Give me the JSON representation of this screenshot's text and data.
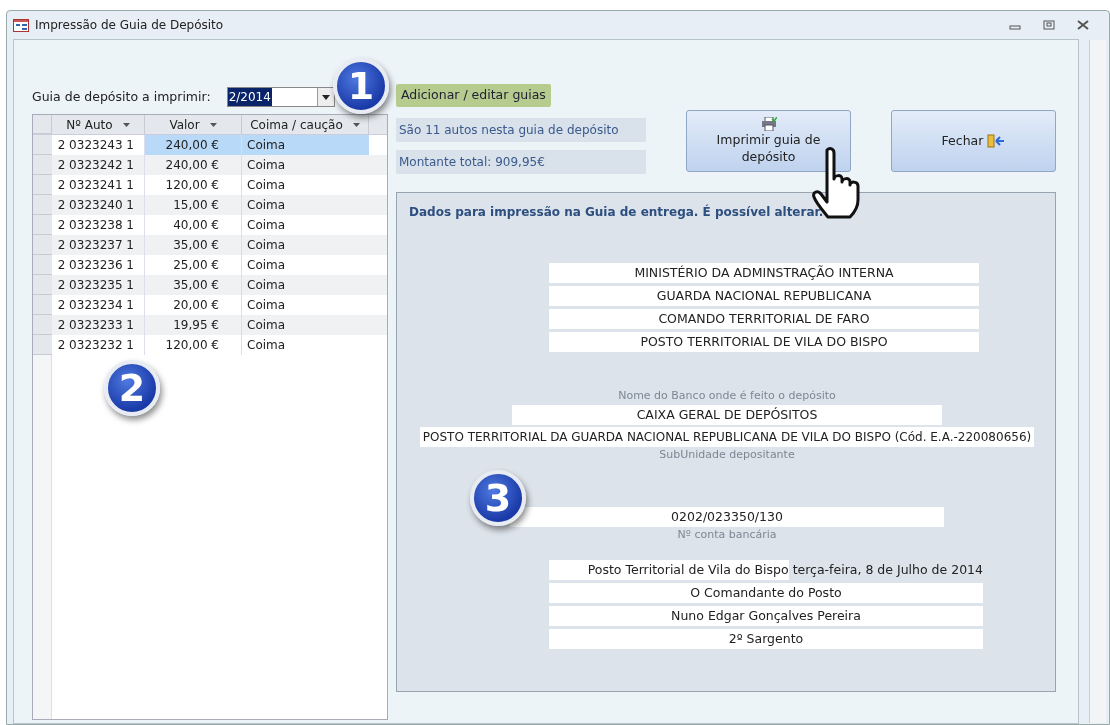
{
  "window": {
    "title": "Impressão de Guia de Depósito"
  },
  "selector": {
    "label": "Guia de depósito a imprimir:",
    "value": "2/2014"
  },
  "add_button": "Adicionar / editar guias",
  "grid": {
    "columns": [
      "Nº Auto",
      "Valor",
      "Coima / caução"
    ],
    "rows": [
      {
        "auto": "2 0323243 1",
        "valor": "240,00 €",
        "tipo": "Coima",
        "selected": true
      },
      {
        "auto": "2 0323242 1",
        "valor": "240,00 €",
        "tipo": "Coima",
        "selected": false
      },
      {
        "auto": "2 0323241 1",
        "valor": "120,00 €",
        "tipo": "Coima",
        "selected": false
      },
      {
        "auto": "2 0323240 1",
        "valor": "15,00 €",
        "tipo": "Coima",
        "selected": false
      },
      {
        "auto": "2 0323238 1",
        "valor": "40,00 €",
        "tipo": "Coima",
        "selected": false
      },
      {
        "auto": "2 0323237 1",
        "valor": "35,00 €",
        "tipo": "Coima",
        "selected": false
      },
      {
        "auto": "2 0323236 1",
        "valor": "25,00 €",
        "tipo": "Coima",
        "selected": false
      },
      {
        "auto": "2 0323235 1",
        "valor": "35,00 €",
        "tipo": "Coima",
        "selected": false
      },
      {
        "auto": "2 0323234 1",
        "valor": "20,00 €",
        "tipo": "Coima",
        "selected": false
      },
      {
        "auto": "2 0323233 1",
        "valor": "19,95 €",
        "tipo": "Coima",
        "selected": false
      },
      {
        "auto": "2 0323232 1",
        "valor": "120,00 €",
        "tipo": "Coima",
        "selected": false
      }
    ]
  },
  "info": {
    "count": "São 11 autos nesta guia de depósito",
    "total": "Montante total: 909,95€"
  },
  "print_button": "Imprimir guia de depósito",
  "close_button": "Fechar",
  "panel": {
    "heading": "Dados para impressão na Guia de entrega. É possível alterar.",
    "header_lines": [
      "MINISTÉRIO DA ADMINSTRAÇÃO INTERNA",
      "GUARDA NACIONAL REPUBLICANA",
      "COMANDO TERRITORIAL DE FARO",
      "POSTO TERRITORIAL DE VILA DO BISPO"
    ],
    "bank_caption": "Nome do Banco onde é feito o depósito",
    "bank": "CAIXA GERAL DE DEPÓSITOS",
    "subunit": "POSTO TERRITORIAL DA GUARDA NACIONAL REPUBLICANA DE VILA DO BISPO (Cód. E.A.-220080656)",
    "subunit_caption": "SubUnidade depositante",
    "account": "0202/023350/130",
    "account_caption": "Nº conta bancária",
    "place": "Posto Territorial de Vila do Bispo",
    "date": "terça-feira, 8 de Julho de 2014",
    "signature_lines": [
      "O Comandante do Posto",
      "Nuno Edgar Gonçalves Pereira",
      "2º Sargento"
    ]
  },
  "callouts": [
    "1",
    "2",
    "3"
  ]
}
